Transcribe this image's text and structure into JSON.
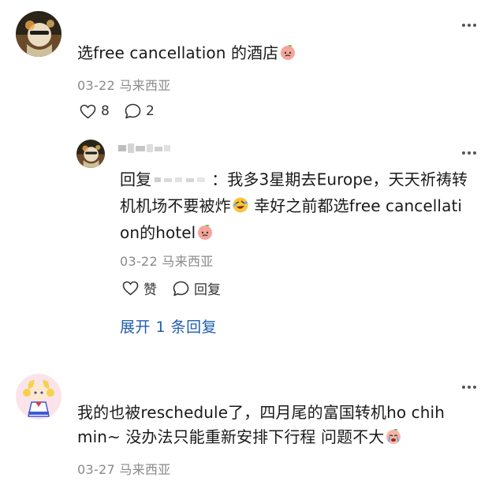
{
  "comment1": {
    "text": "选free cancellation 的酒店",
    "date": "03-22",
    "location": "马来西亚",
    "like_count": "8",
    "reply_count": "2"
  },
  "reply1": {
    "prefix": "回复",
    "after_mention": "：我多3星期去Europe，天天祈祷转",
    "line2_part1": "机机场不要被炸",
    "line2_part2": " 幸好之前都选free cancellati",
    "line3": "on的hotel",
    "date": "03-22",
    "location": "马来西亚",
    "like_label": "赞",
    "reply_label": "回复"
  },
  "expand_label": "展开 1 条回复",
  "comment2": {
    "line1": "我的也被reschedule了，四月尾的富国转机ho chih",
    "line2": "min~ 没办法只能重新安排下行程 问题不大",
    "date": "03-27",
    "location": "马来西亚"
  },
  "icons": {
    "peach_emoji": "peach-face-emoji",
    "rofl_emoji": "rolling-laughing-emoji",
    "crying_emoji": "crying-emoji",
    "like": "heart-icon",
    "reply": "speech-bubble-icon",
    "more": "more-dots-icon"
  },
  "colors": {
    "link_blue": "#1f5eae",
    "meta_gray": "#8a8a8a",
    "text": "#1a1a1a"
  }
}
